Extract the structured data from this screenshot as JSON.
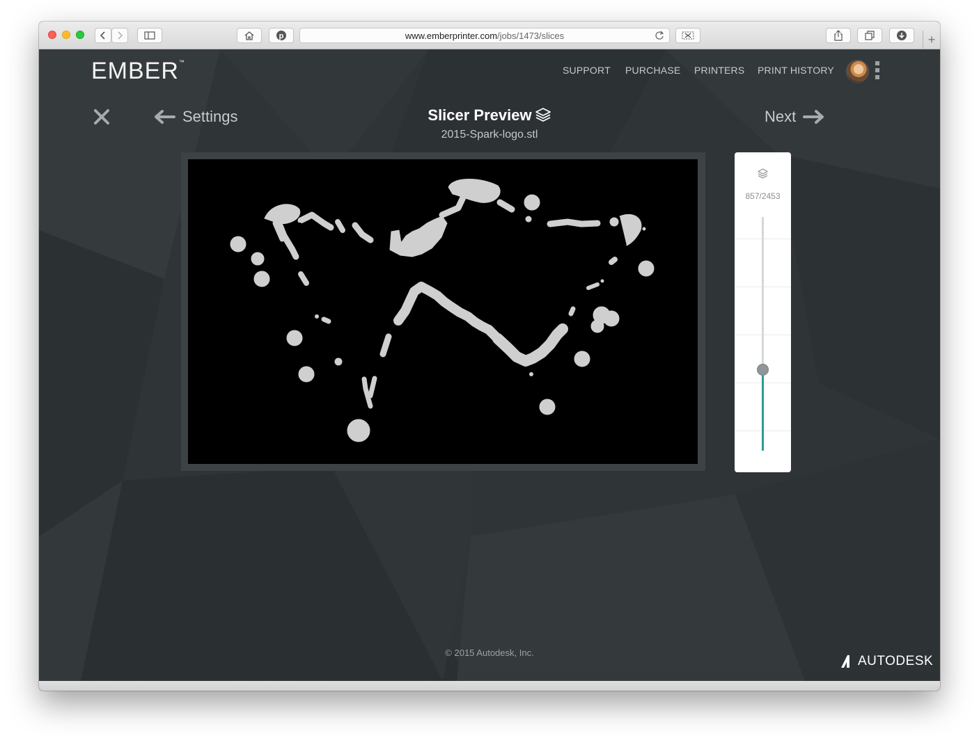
{
  "browser": {
    "url_domain": "www.emberprinter.com",
    "url_path": "/jobs/1473/slices",
    "new_tab_label": "+"
  },
  "header": {
    "logo": "EMBER",
    "logo_mark": "™",
    "nav": [
      "SUPPORT",
      "PURCHASE",
      "PRINTERS",
      "PRINT HISTORY"
    ]
  },
  "subheader": {
    "back_label": "Settings",
    "title": "Slicer Preview",
    "filename": "2015-Spark-logo.stl",
    "next_label": "Next"
  },
  "slice_panel": {
    "layer_count": "857/2453",
    "current_layer": 857,
    "total_layers": 2453
  },
  "footer": {
    "copyright": "© 2015 Autodesk, Inc.",
    "brand": "AUTODESK"
  },
  "colors": {
    "page_bg": "#2f3437",
    "slice_fill": "#cfcfcf",
    "slider_accent": "#2e9a95"
  },
  "icons": {
    "close": "close-icon",
    "back": "arrow-left-icon",
    "next": "arrow-right-icon",
    "layers": "layers-icon"
  }
}
